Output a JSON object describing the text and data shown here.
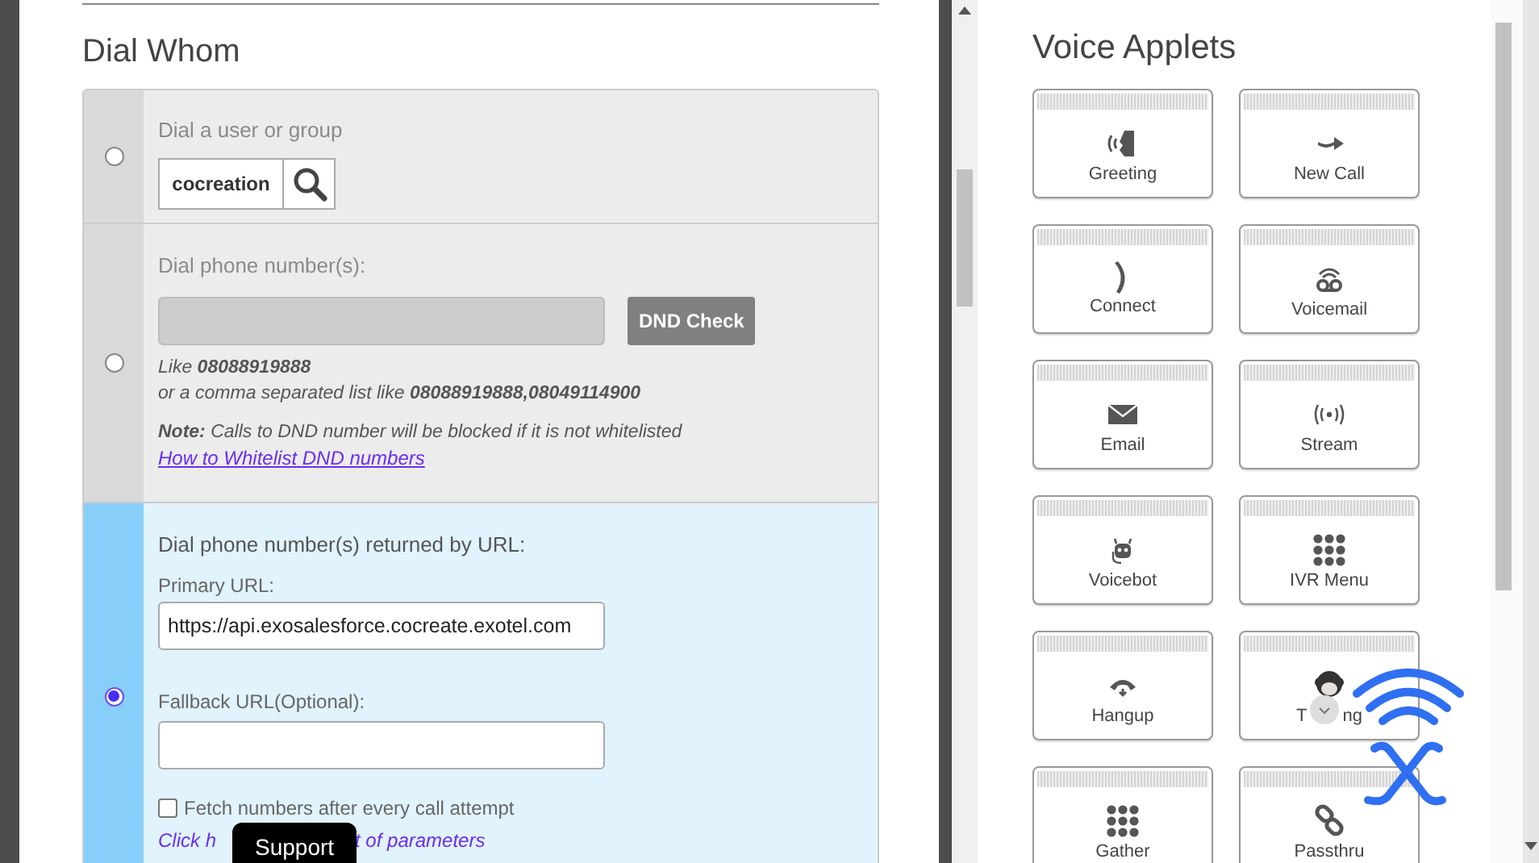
{
  "dial_whom": {
    "title": "Dial Whom",
    "options": [
      {
        "kind": "user_group",
        "selected": false,
        "label": "Dial a user or group",
        "value": "cocreation"
      },
      {
        "kind": "phone_numbers",
        "selected": false,
        "label": "Dial phone number(s):",
        "button": "DND Check",
        "hint_1": "Like **08088919888**",
        "hint_2": "or a comma separated list like **08088919888,08049114900**",
        "note": "**Note:** Calls to DND number will be blocked if it is not whitelisted",
        "link": "How to Whitelist DND numbers"
      },
      {
        "kind": "url",
        "selected": true,
        "label": "Dial phone number(s) returned by URL:",
        "primary_label": "Primary URL:",
        "primary_value": "https://api.exosalesforce.cocreate.exotel.com",
        "fallback_label": "Fallback URL(Optional):",
        "checkbox": {
          "label": "Fetch numbers after every call attempt",
          "checked": false
        },
        "link_start": "Click h",
        "link_end": "t of parameters"
      }
    ]
  },
  "support_button": "Support",
  "voice_applets": {
    "title": "Voice Applets",
    "items": [
      {
        "label": "Greeting"
      },
      {
        "label": "New Call"
      },
      {
        "label": "Connect"
      },
      {
        "label": "Voicemail"
      },
      {
        "label": "Email"
      },
      {
        "label": "Stream"
      },
      {
        "label": "Voicebot"
      },
      {
        "label": "IVR Menu"
      },
      {
        "label": "Hangup"
      },
      {
        "label_start": "T",
        "label_end": "ng"
      },
      {
        "label": "Gather"
      },
      {
        "label": "Passthru"
      }
    ]
  }
}
